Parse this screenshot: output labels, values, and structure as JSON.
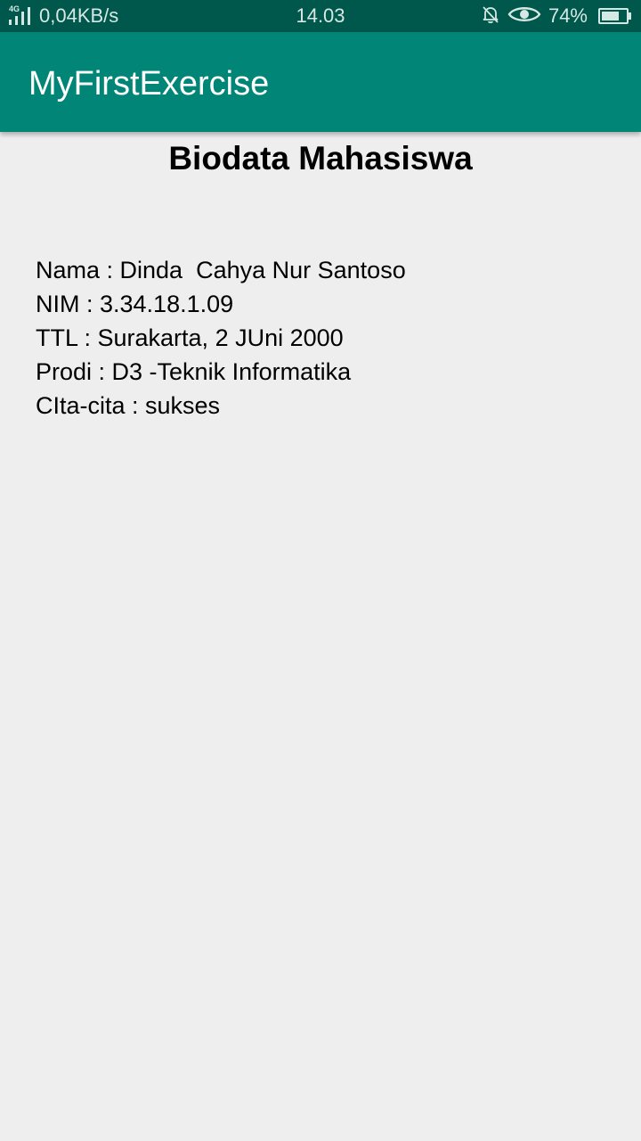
{
  "status_bar": {
    "network_type": "4G",
    "data_speed": "0,04KB/s",
    "time": "14.03",
    "icons": [
      "mute-bell-icon",
      "eye-icon"
    ],
    "battery_percent_label": "74%",
    "battery_level": 0.74
  },
  "app_bar": {
    "title": "MyFirstExercise"
  },
  "main": {
    "heading": "Biodata Mahasiswa",
    "lines": [
      "Nama : Dinda  Cahya Nur Santoso",
      "NIM : 3.34.18.1.09",
      "TTL : Surakarta, 2 JUni 2000",
      "Prodi : D3 -Teknik Informatika",
      "CIta-cita : sukses"
    ]
  },
  "colors": {
    "status_bar": "#00574b",
    "app_bar": "#008577",
    "background": "#eeeeee",
    "text": "#000000"
  }
}
